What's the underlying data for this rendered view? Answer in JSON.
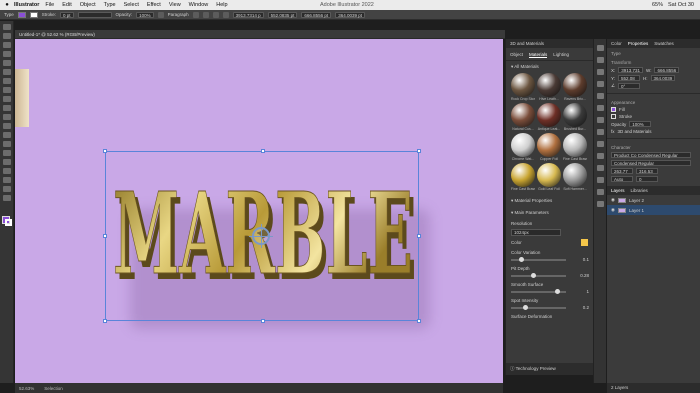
{
  "menubar": {
    "apple": "",
    "app": "Illustrator",
    "items": [
      "File",
      "Edit",
      "Object",
      "Type",
      "Select",
      "Effect",
      "View",
      "Window",
      "Help"
    ],
    "window_title": "Adobe Illustrator 2022",
    "battery": "65%",
    "clock": "Sat Oct 30"
  },
  "controlbar": {
    "type_label": "Type",
    "stroke_label": "Stroke:",
    "stroke_value": "0 pt",
    "opacity_label": "Opacity:",
    "opacity_value": "100%",
    "paragraph_label": "Paragraph",
    "x_value": "3913.7314 p",
    "y_value": "552.0835 pt",
    "w_value": "666.8556 pt",
    "h_value": "364.0039 pt"
  },
  "document": {
    "tab_title": "Untitled-1* @ 52.62 % (RGB/Preview)",
    "artwork_text": "MARBLE",
    "canvas_color": "#c9a8e7"
  },
  "statusbar": {
    "zoom": "52.63%",
    "tool": "Selection"
  },
  "panel3d": {
    "title": "3D and Materials",
    "tabs": [
      "Object",
      "Materials",
      "Lighting"
    ],
    "active_tab": "Materials",
    "all_materials": "All Materials",
    "materials": [
      {
        "name": "Rock Crop Stone",
        "color": "#6b5540"
      },
      {
        "name": "Hive Leath...",
        "color": "#4a3a35"
      },
      {
        "name": "Ravens Bric...",
        "color": "#5d3c2c"
      },
      {
        "name": "Natural Cus...",
        "color": "#7a4d3a"
      },
      {
        "name": "Antique Leat...",
        "color": "#6e2f26"
      },
      {
        "name": "Brushed Bur...",
        "color": "#3a3a3a"
      },
      {
        "name": "Chrome Wat...",
        "color": "#cfcfcf"
      },
      {
        "name": "Copper Foil",
        "color": "#b0703f"
      },
      {
        "name": "Fine Cast Brass",
        "color": "#b7b7b7"
      },
      {
        "name": "Fine Cast Brass",
        "color": "#c8a430"
      },
      {
        "name": "Gold Leaf Foil",
        "color": "#d7b950"
      },
      {
        "name": "Soft Hammer...",
        "color": "#9c9c9c"
      }
    ],
    "material_properties": "Material Properties",
    "main_parameters": "Main Parameters",
    "resolution_label": "Resolution",
    "resolution_value": "1024px",
    "color_label": "Color",
    "color_value": "#f4c64a",
    "color_variation_label": "Color Variation",
    "color_variation_value": "0.1",
    "pit_depth_label": "Pit Depth",
    "pit_depth_value": "0.28",
    "smooth_surface_label": "Smooth Surface",
    "smooth_surface_value": "1",
    "spot_intensity_label": "Spot Intensity",
    "spot_intensity_value": "0.2",
    "surface_deformation_label": "Surface Deformation",
    "technology_preview": "Technology Preview"
  },
  "rightpanel": {
    "tabs": [
      "Color",
      "Properties",
      "Swatches"
    ],
    "active_tab": "Properties",
    "type_label": "Type",
    "transform_label": "Transform",
    "x_value": "3913.731",
    "y_value": "552.08",
    "w_value": "666.8556",
    "h_value": "364.0039",
    "angle_value": "0°",
    "appearance_label": "Appearance",
    "fill_label": "Fill",
    "stroke_label": "Stroke",
    "opacity_label": "Opacity",
    "opacity_value": "100%",
    "fx_label": "3D and Materials",
    "character_label": "Character",
    "font_family": "Product Co Condensed Regular",
    "font_style": "Condensed Regular",
    "font_size": "263.77",
    "leading": "316.53",
    "tracking": "Auto",
    "kerning": "0",
    "layers_tabs": [
      "Layers",
      "Libraries"
    ],
    "layers": [
      {
        "name": "Layer 2",
        "selected": false
      },
      {
        "name": "Layer 1",
        "selected": true
      }
    ],
    "footer": "2 Layers"
  }
}
